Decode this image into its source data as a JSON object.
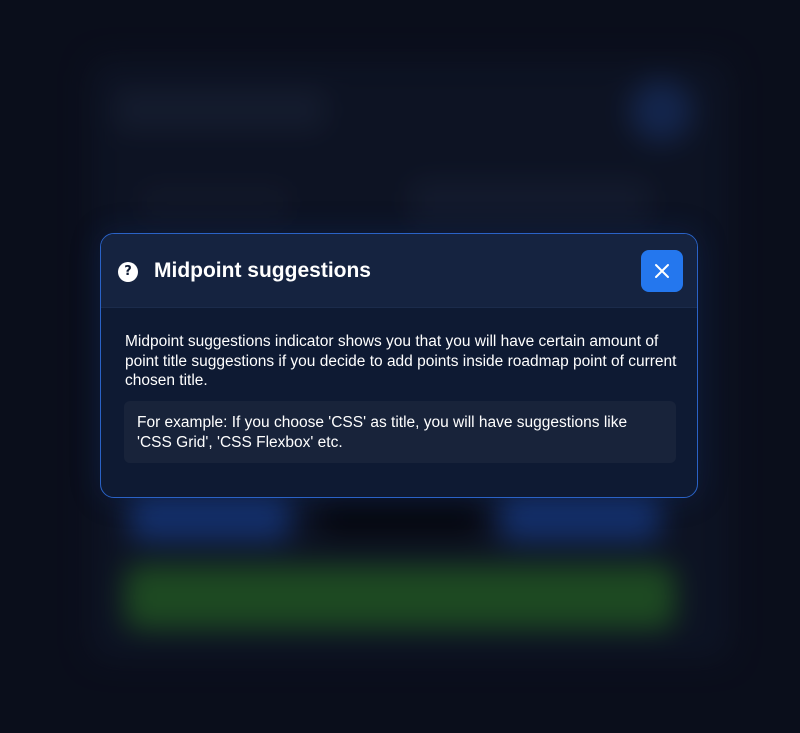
{
  "modal": {
    "title": "Midpoint suggestions",
    "icon": "question-circle-icon",
    "close_icon": "close-icon",
    "description": "Midpoint suggestions indicator shows you that you will have certain amount of point title suggestions if you decide to add points inside roadmap point of current chosen title.",
    "example": "For example: If you choose 'CSS' as title, you will have suggestions like 'CSS Grid', 'CSS Flexbox' etc."
  },
  "colors": {
    "accent": "#2477ee",
    "modal_background": "#0e1a33",
    "modal_header": "#152340",
    "modal_border": "#2a62c6",
    "example_background": "#18233a",
    "page_background": "#0b0f1e"
  }
}
